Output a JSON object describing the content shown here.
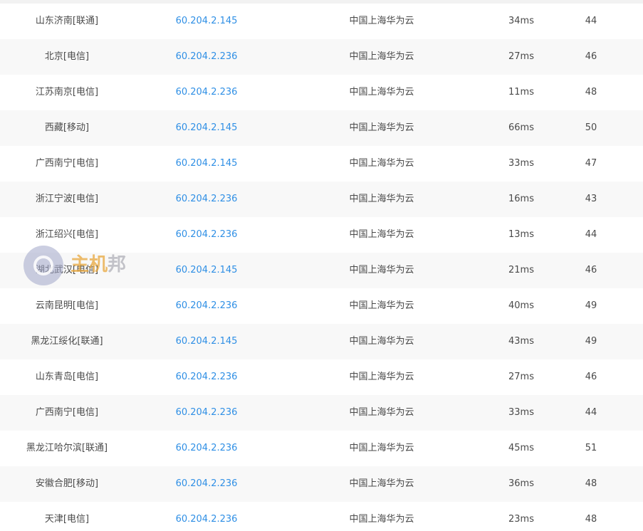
{
  "table": {
    "rows": [
      {
        "location": "山东济南[联通]",
        "ip": "60.204.2.145",
        "geo": "中国上海华为云",
        "time": "34ms",
        "ttl": "44"
      },
      {
        "location": "北京[电信]",
        "ip": "60.204.2.236",
        "geo": "中国上海华为云",
        "time": "27ms",
        "ttl": "46"
      },
      {
        "location": "江苏南京[电信]",
        "ip": "60.204.2.236",
        "geo": "中国上海华为云",
        "time": "11ms",
        "ttl": "48"
      },
      {
        "location": "西藏[移动]",
        "ip": "60.204.2.145",
        "geo": "中国上海华为云",
        "time": "66ms",
        "ttl": "50"
      },
      {
        "location": "广西南宁[电信]",
        "ip": "60.204.2.145",
        "geo": "中国上海华为云",
        "time": "33ms",
        "ttl": "47"
      },
      {
        "location": "浙江宁波[电信]",
        "ip": "60.204.2.236",
        "geo": "中国上海华为云",
        "time": "16ms",
        "ttl": "43"
      },
      {
        "location": "浙江绍兴[电信]",
        "ip": "60.204.2.236",
        "geo": "中国上海华为云",
        "time": "13ms",
        "ttl": "44"
      },
      {
        "location": "湖北武汉[电信]",
        "ip": "60.204.2.145",
        "geo": "中国上海华为云",
        "time": "21ms",
        "ttl": "46"
      },
      {
        "location": "云南昆明[电信]",
        "ip": "60.204.2.236",
        "geo": "中国上海华为云",
        "time": "40ms",
        "ttl": "49"
      },
      {
        "location": "黑龙江绥化[联通]",
        "ip": "60.204.2.145",
        "geo": "中国上海华为云",
        "time": "43ms",
        "ttl": "49"
      },
      {
        "location": "山东青岛[电信]",
        "ip": "60.204.2.236",
        "geo": "中国上海华为云",
        "time": "27ms",
        "ttl": "46"
      },
      {
        "location": "广西南宁[电信]",
        "ip": "60.204.2.236",
        "geo": "中国上海华为云",
        "time": "33ms",
        "ttl": "44"
      },
      {
        "location": "黑龙江哈尔滨[联通]",
        "ip": "60.204.2.236",
        "geo": "中国上海华为云",
        "time": "45ms",
        "ttl": "51"
      },
      {
        "location": "安徽合肥[移动]",
        "ip": "60.204.2.236",
        "geo": "中国上海华为云",
        "time": "36ms",
        "ttl": "48"
      },
      {
        "location": "天津[电信]",
        "ip": "60.204.2.236",
        "geo": "中国上海华为云",
        "time": "23ms",
        "ttl": "48"
      }
    ]
  },
  "watermark": {
    "icon": "site-logo-icon",
    "text_part1": "主机",
    "text_part2": "邦"
  },
  "colors": {
    "ip_link": "#2f8fe5",
    "text": "#4a4a4a",
    "alt_row": "#f8f8f8"
  }
}
